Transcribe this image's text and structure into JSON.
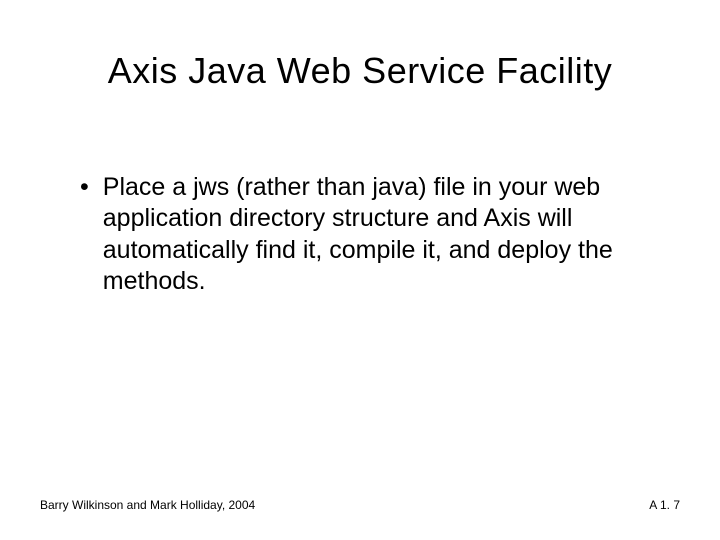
{
  "title": "Axis Java Web Service Facility",
  "bullets": [
    "Place a jws (rather than java) file in your web application directory structure and Axis will automatically find it, compile it, and deploy the methods."
  ],
  "footer": {
    "left": "Barry Wilkinson and Mark Holliday, 2004",
    "right": "A 1. 7"
  }
}
